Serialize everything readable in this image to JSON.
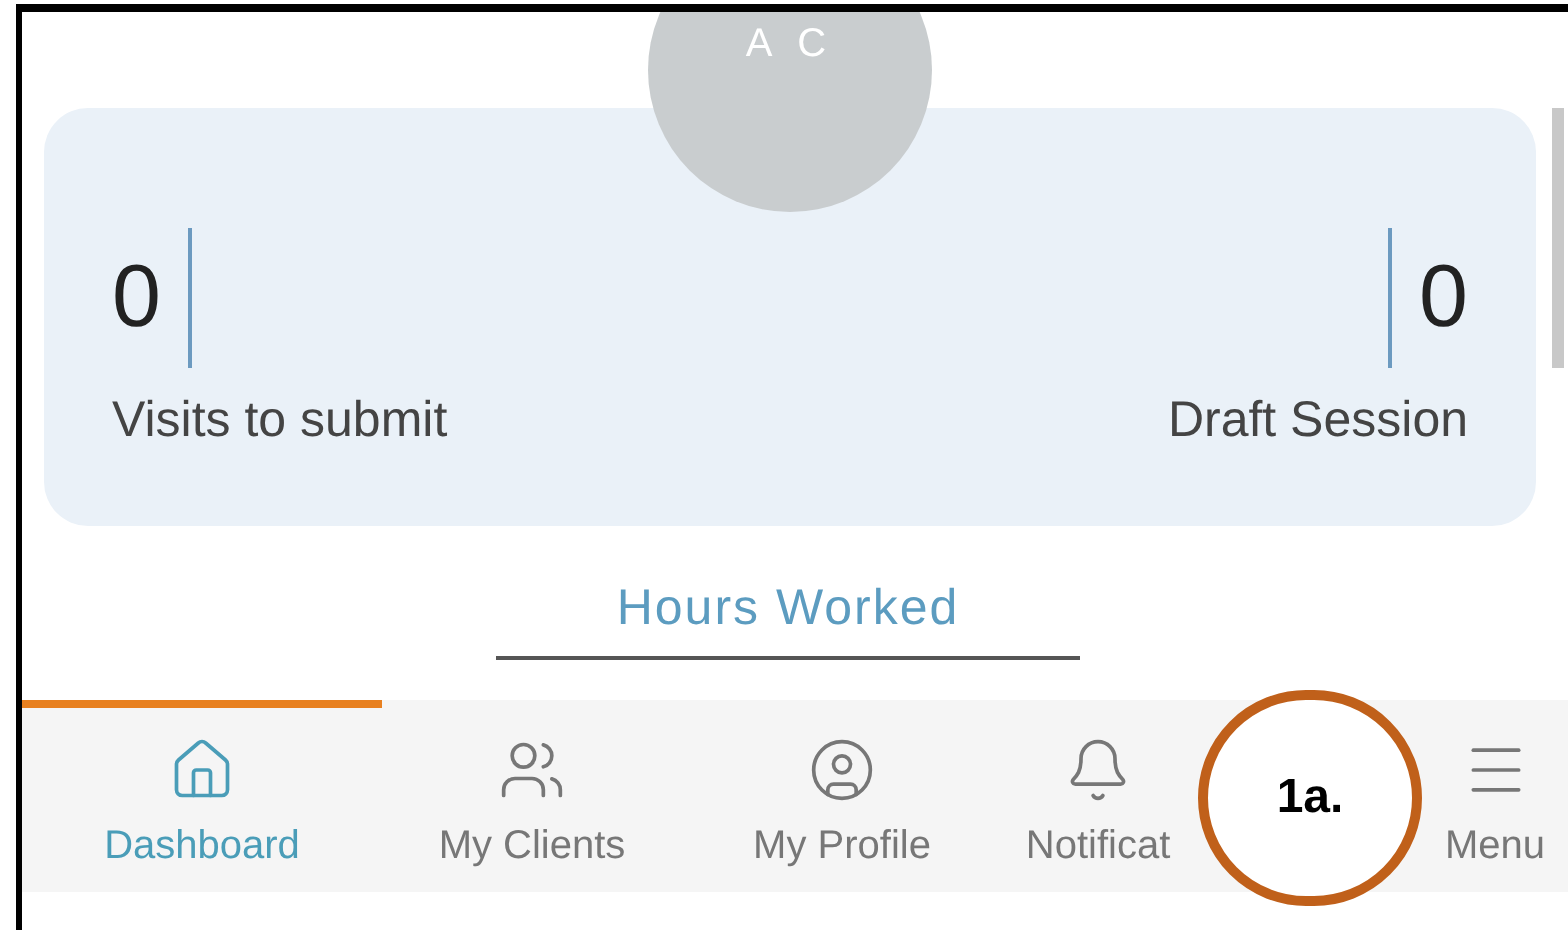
{
  "avatar": {
    "initials": "A C"
  },
  "summary": {
    "visits": {
      "value": "0",
      "label": "Visits to submit"
    },
    "drafts": {
      "value": "0",
      "label": "Draft Session"
    }
  },
  "hours_worked": {
    "label": "Hours Worked"
  },
  "tabs": [
    {
      "label": "Dashboard",
      "selected": true
    },
    {
      "label": "My Clients",
      "selected": false
    },
    {
      "label": "My Profile",
      "selected": false
    },
    {
      "label": "Notificat",
      "selected": false
    },
    {
      "label": "Menu",
      "selected": false
    }
  ],
  "annotation": {
    "label": "1a."
  }
}
